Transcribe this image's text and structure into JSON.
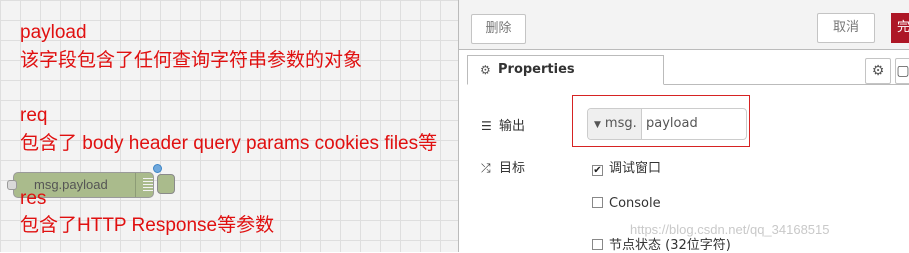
{
  "annotations": [
    "payload",
    "该字段包含了任何查询字符串参数的对象",
    "req",
    "包含了 body header query params cookies files等",
    "res",
    "包含了HTTP Response等参数"
  ],
  "node": {
    "label": "msg.payload"
  },
  "panel": {
    "delete_label": "删除",
    "cancel_label": "取消",
    "done_label": "完",
    "tab_label": "Properties",
    "output_label": "输出",
    "output_type": "msg.",
    "output_value": "payload",
    "target_label": "目标",
    "debug_window_label": "调试窗口",
    "debug_window_checked": true,
    "console_label": "Console",
    "console_checked": false,
    "node_status_label": "节点状态 (32位字符)",
    "node_status_checked": false
  },
  "watermark": "https://blog.csdn.net/qq_34168515",
  "colors": {
    "annotation": "#e01010",
    "node_fill": "#aabb8c",
    "done_button": "#ad1625",
    "highlight_frame": "#d62323"
  },
  "icons": [
    "gear-icon",
    "list-icon",
    "shuffle-icon",
    "caret-down-icon",
    "frame-icon",
    "check-icon"
  ]
}
